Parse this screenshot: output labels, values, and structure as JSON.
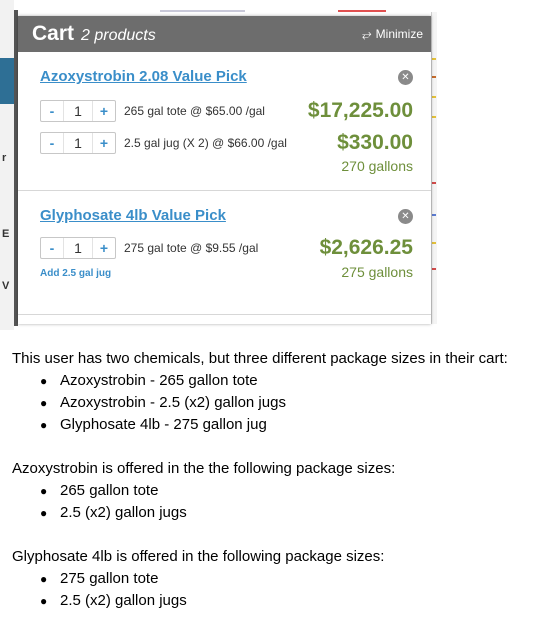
{
  "cart": {
    "title": "Cart",
    "count": "2 products",
    "minimize_label": "Minimize",
    "minimize_icon": "minimize-arrows-icon",
    "items": [
      {
        "name": "Azoxystrobin 2.08 Value Pick",
        "lines": [
          {
            "minus": "-",
            "qty": "1",
            "plus": "+",
            "package": "265 gal tote @ $65.00 /gal",
            "price": "$17,225.00"
          },
          {
            "minus": "-",
            "qty": "1",
            "plus": "+",
            "package": "2.5 gal jug (X 2) @ $66.00 /gal",
            "price": "$330.00"
          }
        ],
        "gallons": "270 gallons"
      },
      {
        "name": "Glyphosate 4lb Value Pick",
        "lines": [
          {
            "minus": "-",
            "qty": "1",
            "plus": "+",
            "package": "275 gal tote @ $9.55 /gal",
            "price": "$2,626.25"
          }
        ],
        "add_link": "Add 2.5 gal jug",
        "gallons": "275 gallons"
      }
    ]
  },
  "background_marks": [
    "r",
    "E",
    "V"
  ],
  "colors": {
    "header": "#6d6d6d",
    "link": "#3a8ec9",
    "price": "#6e8f3b"
  },
  "notes": {
    "intro": "This user has two chemicals, but three different package sizes in their cart:",
    "cart_list": [
      "Azoxystrobin - 265 gallon tote",
      "Azoxystrobin - 2.5 (x2) gallon jugs",
      "Glyphosate 4lb - 275 gallon jug"
    ],
    "azoxy_intro": "Azoxystrobin is offered in the the following package sizes:",
    "azoxy_list": [
      "265 gallon tote",
      "2.5 (x2) gallon jugs"
    ],
    "glypho_intro": "Glyphosate 4lb is offered in the following package sizes:",
    "glypho_list": [
      "275 gallon tote",
      "2.5 (x2) gallon jugs"
    ]
  }
}
